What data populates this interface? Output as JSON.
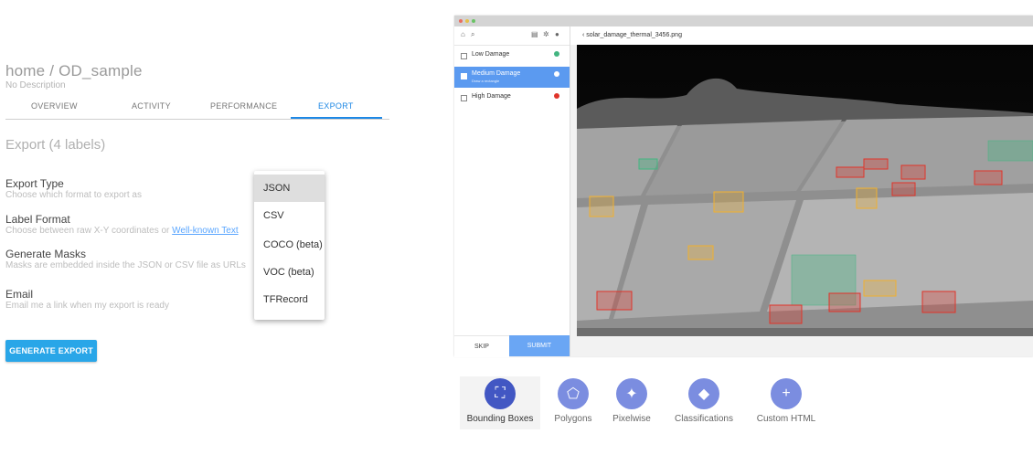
{
  "export_panel": {
    "breadcrumb": "home / OD_sample",
    "description": "No Description",
    "tabs": [
      "OVERVIEW",
      "ACTIVITY",
      "PERFORMANCE",
      "EXPORT"
    ],
    "active_tab": "EXPORT",
    "section_title": "Export (4 labels)",
    "fields": [
      {
        "label": "Export Type",
        "help": "Choose which format to export as"
      },
      {
        "label": "Label Format",
        "help": "Choose between raw X-Y coordinates or",
        "link": "Well-known Text"
      },
      {
        "label": "Generate Masks",
        "help": "Masks are embedded inside the JSON or CSV file as URLs"
      },
      {
        "label": "Email",
        "help": "Email me a link when my export is ready"
      }
    ],
    "format_options": [
      "JSON",
      "CSV",
      "COCO (beta)",
      "VOC (beta)",
      "TFRecord"
    ],
    "selected_format": "JSON",
    "generate_button": "GENERATE EXPORT"
  },
  "labeling_app": {
    "filename": "solar_damage_thermal_3456.png",
    "classes": [
      {
        "label": "Low Damage",
        "color": "#43b581"
      },
      {
        "label": "Medium Damage",
        "sublabel": "Draw a rectangle",
        "color": "#f0b030",
        "active": true
      },
      {
        "label": "High Damage",
        "color": "#e0342a"
      }
    ],
    "skip_label": "SKIP",
    "submit_label": "SUBMIT"
  },
  "tools": [
    {
      "label": "Bounding Boxes",
      "icon": "bounding-box-icon",
      "active": true
    },
    {
      "label": "Polygons",
      "icon": "polygon-icon"
    },
    {
      "label": "Pixelwise",
      "icon": "magic-wand-icon"
    },
    {
      "label": "Classifications",
      "icon": "tag-icon"
    },
    {
      "label": "Custom HTML",
      "icon": "plus-icon"
    }
  ],
  "colors": {
    "accent": "#1e88e5",
    "button": "#29a6e8",
    "tool_circle": "#7b8de0",
    "tool_active": "#4257c3",
    "low_damage": "#43b581",
    "medium_damage": "#f0b030",
    "high_damage": "#e0342a"
  }
}
